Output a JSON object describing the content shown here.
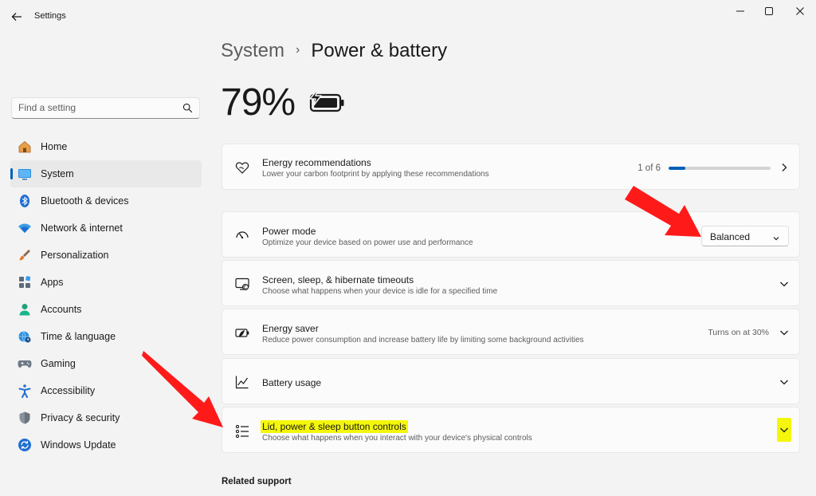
{
  "window": {
    "title": "Settings",
    "controls": {
      "minimize": "—",
      "maximize": "☐",
      "close": "✕"
    }
  },
  "search": {
    "placeholder": "Find a setting",
    "icon": "search-icon"
  },
  "sidebar": {
    "items": [
      {
        "label": "Home",
        "icon": "home-icon",
        "active": false
      },
      {
        "label": "System",
        "icon": "monitor-icon",
        "active": true
      },
      {
        "label": "Bluetooth & devices",
        "icon": "bluetooth-icon",
        "active": false
      },
      {
        "label": "Network & internet",
        "icon": "wifi-icon",
        "active": false
      },
      {
        "label": "Personalization",
        "icon": "brush-icon",
        "active": false
      },
      {
        "label": "Apps",
        "icon": "apps-icon",
        "active": false
      },
      {
        "label": "Accounts",
        "icon": "person-icon",
        "active": false
      },
      {
        "label": "Time & language",
        "icon": "globe-clock-icon",
        "active": false
      },
      {
        "label": "Gaming",
        "icon": "gamepad-icon",
        "active": false
      },
      {
        "label": "Accessibility",
        "icon": "accessibility-icon",
        "active": false
      },
      {
        "label": "Privacy & security",
        "icon": "shield-icon",
        "active": false
      },
      {
        "label": "Windows Update",
        "icon": "update-icon",
        "active": false
      }
    ]
  },
  "breadcrumb": {
    "parent": "System",
    "separator": "›",
    "current": "Power & battery"
  },
  "battery": {
    "percent_text": "79%",
    "level": 0.79,
    "charging": true
  },
  "cards": {
    "energy_recommendations": {
      "title": "Energy recommendations",
      "description": "Lower your carbon footprint by applying these recommendations",
      "progress_text": "1 of 6",
      "progress_fraction": 0.1667
    },
    "power_mode": {
      "title": "Power mode",
      "description": "Optimize your device based on power use and performance",
      "selected": "Balanced"
    },
    "screen_sleep": {
      "title": "Screen, sleep, & hibernate timeouts",
      "description": "Choose what happens when your device is idle for a specified time"
    },
    "energy_saver": {
      "title": "Energy saver",
      "description": "Reduce power consumption and increase battery life by limiting some background activities",
      "status": "Turns on at 30%"
    },
    "battery_usage": {
      "title": "Battery usage"
    },
    "lid_power": {
      "title": "Lid, power & sleep button controls",
      "description": "Choose what happens when you interact with your device's physical controls"
    }
  },
  "related_support": {
    "heading": "Related support"
  },
  "colors": {
    "accent": "#005fb8",
    "highlight": "#f4f70a",
    "annotation_arrow": "#ff1a1a",
    "background": "#f3f3f3",
    "card": "#fbfbfb"
  }
}
